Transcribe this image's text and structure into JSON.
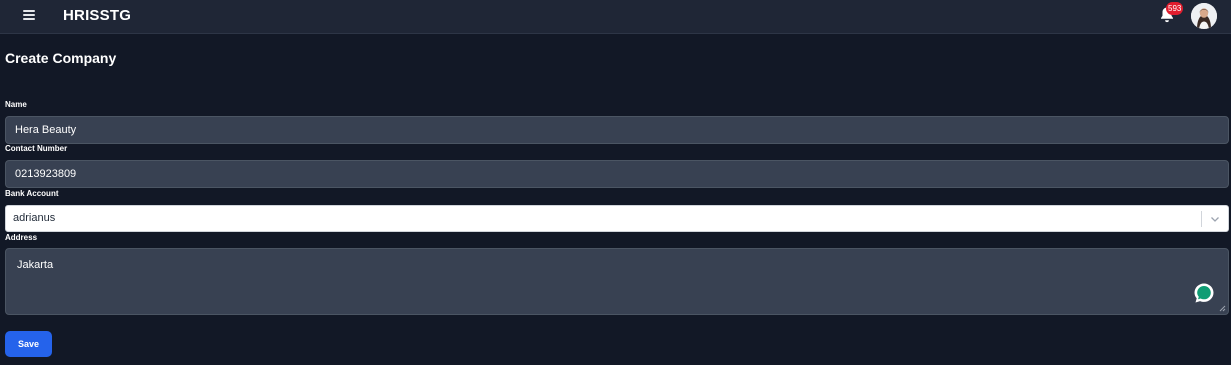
{
  "header": {
    "title": "HRISSTG",
    "menu_icon": "hamburger-menu-icon",
    "notification_icon": "bell-icon",
    "notification_count": "593",
    "avatar": "user-avatar"
  },
  "page": {
    "title": "Create Company"
  },
  "form": {
    "name": {
      "label": "Name",
      "value": "Hera Beauty"
    },
    "contact_number": {
      "label": "Contact Number",
      "value": "0213923809"
    },
    "bank_account": {
      "label": "Bank Account",
      "value": "adrianus",
      "icon": "chevron-down-icon"
    },
    "address": {
      "label": "Address",
      "value": "Jakarta"
    },
    "save_label": "Save"
  },
  "colors": {
    "background": "#121826",
    "topbar": "#1f2636",
    "input_bg": "#384152",
    "primary": "#2563eb",
    "badge": "#e11d2e",
    "chat_icon": "#0f9d74"
  },
  "floating": {
    "chat_icon": "chat-bubble-icon"
  }
}
